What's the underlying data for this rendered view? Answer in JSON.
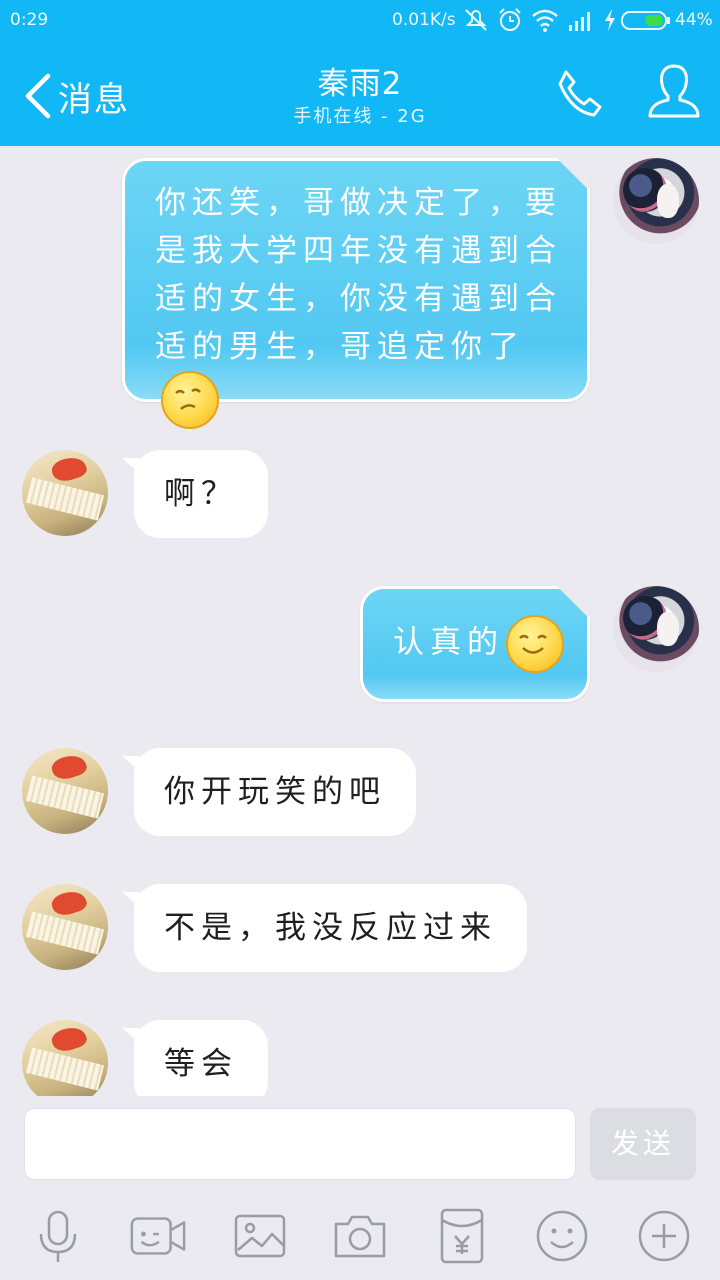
{
  "status_bar": {
    "time": "0:29",
    "net_speed": "0.01K/s",
    "battery": "44%",
    "icons": [
      "mute-icon",
      "alarm-icon",
      "wifi-icon",
      "signal-icon",
      "charging-icon",
      "battery-icon"
    ]
  },
  "header": {
    "back_label": "消息",
    "contact_name": "秦雨2",
    "contact_status": "手机在线 - 2G"
  },
  "messages": [
    {
      "from": "me",
      "text": "你还笑，哥做决定了，要是我大学四年没有遇到合适的女生，你没有遇到合适的男生，哥追定你了",
      "emoji": "sad-face-emoji"
    },
    {
      "from": "them",
      "text": "啊？"
    },
    {
      "from": "me",
      "text": "认真的",
      "emoji": "smile-face-emoji"
    },
    {
      "from": "them",
      "text": "你开玩笑的吧"
    },
    {
      "from": "them",
      "text": "不是，我没反应过来"
    },
    {
      "from": "them",
      "text": "等会"
    }
  ],
  "composer": {
    "value": "",
    "placeholder": "",
    "send_label": "发送"
  },
  "toolbar": {
    "items": [
      "microphone-icon",
      "video-chat-icon",
      "image-icon",
      "camera-icon",
      "red-packet-icon",
      "emoji-icon",
      "plus-icon"
    ]
  },
  "colors": {
    "accent": "#12b7f5",
    "bubble_me": "#52c8f2",
    "bubble_them": "#ffffff",
    "chat_background": "#eaeaf0"
  }
}
